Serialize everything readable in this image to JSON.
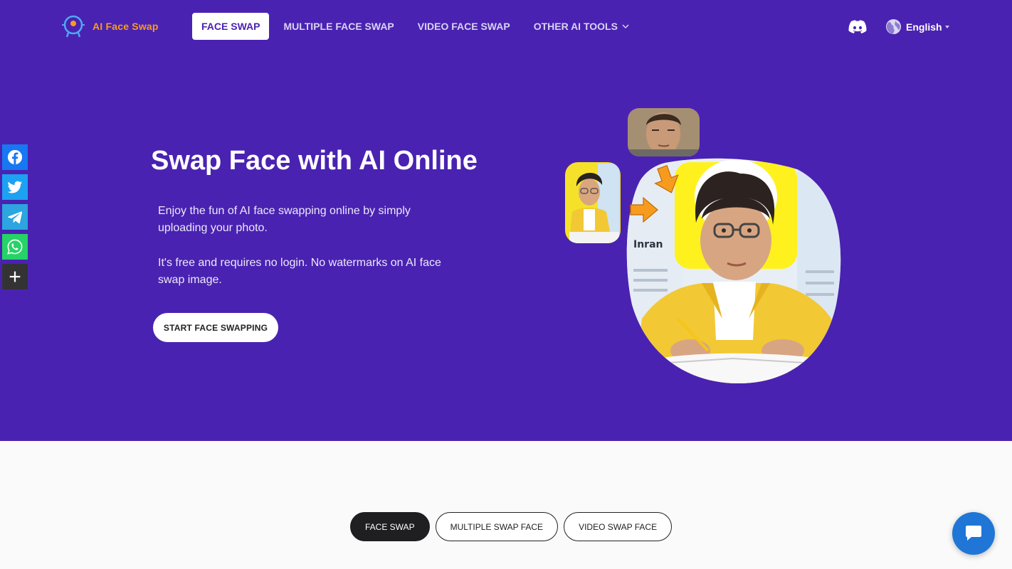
{
  "brand": {
    "name": "AI Face Swap",
    "accent": "#f59a23",
    "hero_bg": "#4a22b1"
  },
  "nav": {
    "items": [
      {
        "label": "FACE SWAP",
        "active": true
      },
      {
        "label": "MULTIPLE FACE SWAP",
        "active": false
      },
      {
        "label": "VIDEO FACE SWAP",
        "active": false
      },
      {
        "label": "OTHER AI TOOLS",
        "active": false,
        "icon": "chevron-down-icon"
      }
    ],
    "discord_icon": "discord-icon",
    "language": "English"
  },
  "hero": {
    "title": "Swap Face with AI Online",
    "paragraph1": "Enjoy the fun of AI face swapping online by simply uploading your photo.",
    "paragraph2": "It's free and requires no login. No watermarks on AI face swap image.",
    "cta": "START FACE SWAPPING"
  },
  "social": [
    {
      "name": "facebook-icon",
      "color": "#1877f2"
    },
    {
      "name": "twitter-icon",
      "color": "#1da1f2"
    },
    {
      "name": "telegram-icon",
      "color": "#2ca5e0"
    },
    {
      "name": "whatsapp-icon",
      "color": "#25d366"
    },
    {
      "name": "more-icon",
      "color": "#333333"
    }
  ],
  "tabs": [
    {
      "label": "FACE SWAP",
      "active": true
    },
    {
      "label": "MULTIPLE SWAP FACE",
      "active": false
    },
    {
      "label": "VIDEO SWAP FACE",
      "active": false
    }
  ],
  "chat_icon": "chat-icon"
}
